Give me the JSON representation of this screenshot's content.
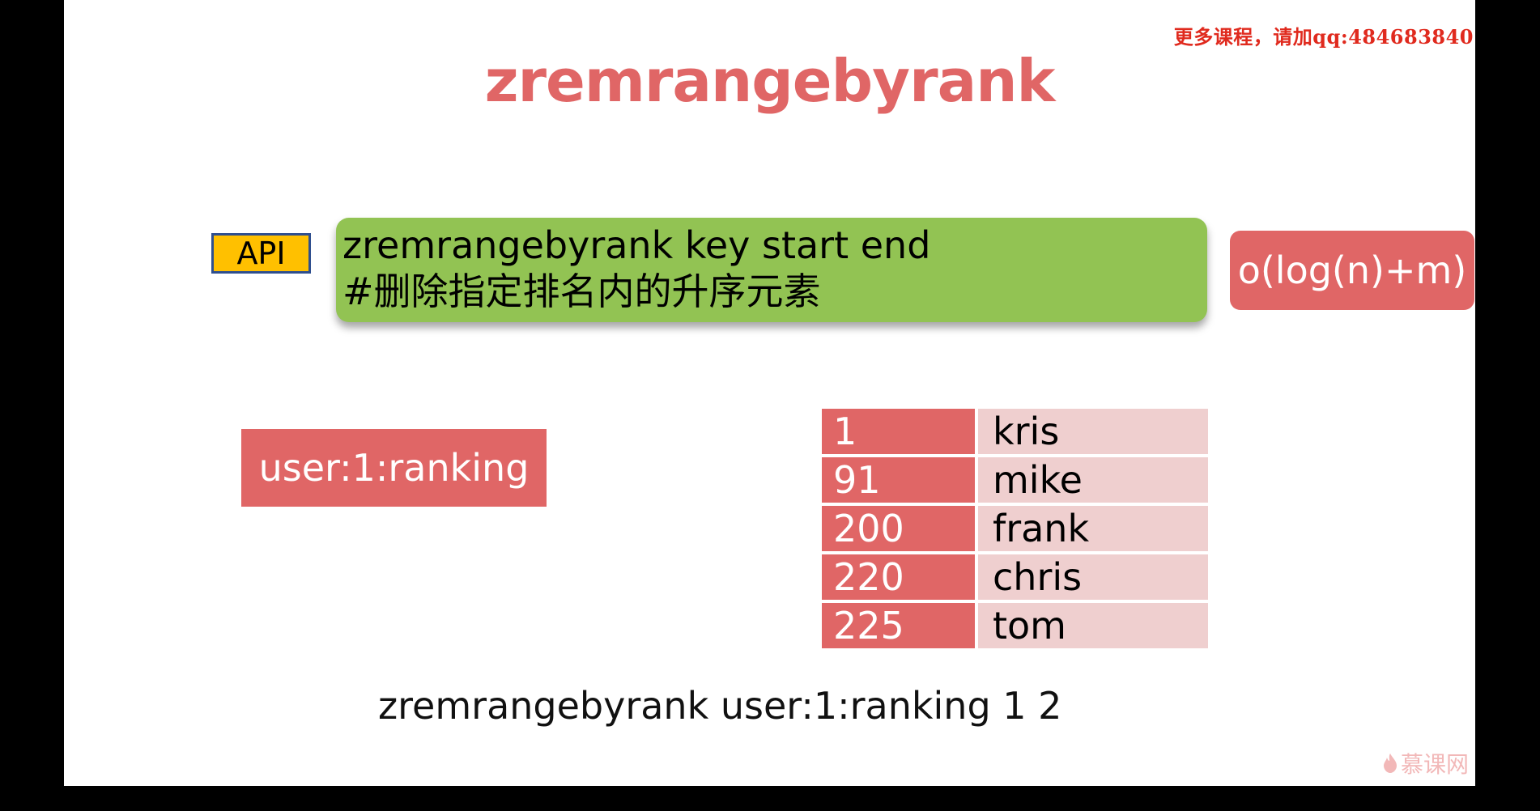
{
  "watermark": "更多课程，请加qq:484683840",
  "title": "zremrangebyrank",
  "api_badge": "API",
  "command": {
    "syntax": "zremrangebyrank key start end",
    "description": "#删除指定排名内的升序元素"
  },
  "complexity": "o(log(n)+m)",
  "key_name": "user:1:ranking",
  "zset": {
    "rows": [
      {
        "score": "1",
        "member": "kris"
      },
      {
        "score": "91",
        "member": "mike"
      },
      {
        "score": "200",
        "member": "frank"
      },
      {
        "score": "220",
        "member": "chris"
      },
      {
        "score": "225",
        "member": "tom"
      }
    ]
  },
  "example": "zremrangebyrank user:1:ranking 1 2",
  "logo": {
    "icon": "flame-icon",
    "text": "慕课网"
  },
  "colors": {
    "accent_red": "#e06666",
    "api_yellow": "#ffc000",
    "command_green": "#92c353",
    "member_pink": "#efcfcf",
    "watermark_red": "#e02a1e"
  }
}
